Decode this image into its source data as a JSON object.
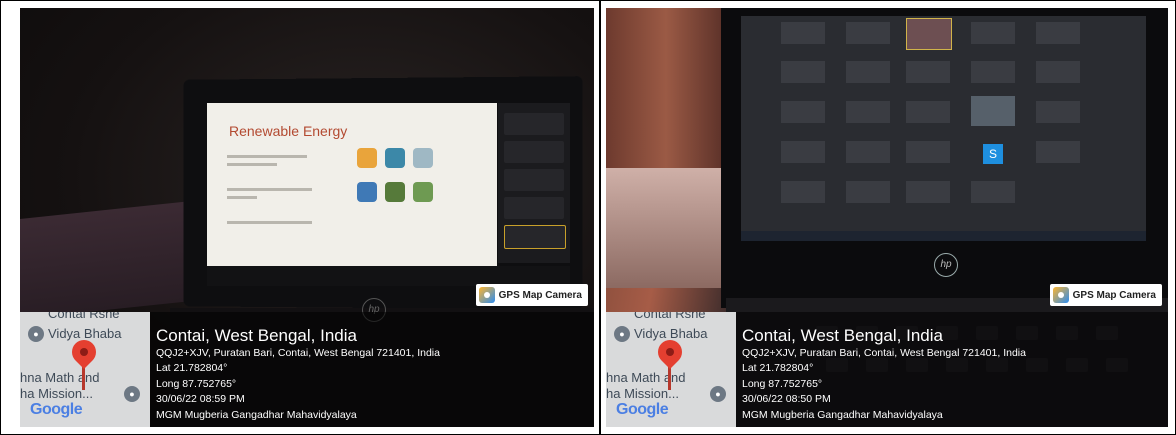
{
  "slide": {
    "title": "Renewable Energy"
  },
  "zoom": {
    "tile_letter": "S"
  },
  "geotag": {
    "app_name": "GPS Map Camera",
    "map_labels": [
      "Contai Rshe",
      "Vidya Bhaba",
      "hna Math and",
      "ha Mission...",
      "Google"
    ],
    "city": "Contai, West Bengal, India",
    "address": "QQJ2+XJV, Puratan Bari, Contai, West Bengal 721401, India",
    "lat": "Lat 21.782804°",
    "long": "Long 87.752765°",
    "institution": "MGM Mugberia Gangadhar Mahavidyalaya"
  },
  "photos": [
    {
      "datetime": "30/06/22 08:59 PM"
    },
    {
      "datetime": "30/06/22 08:50 PM"
    }
  ],
  "brand": {
    "hp": "hp"
  },
  "colors": {
    "pin": "#e43f30",
    "slide_title": "#b34a31",
    "zoom_tile": "#1e8fdf"
  }
}
